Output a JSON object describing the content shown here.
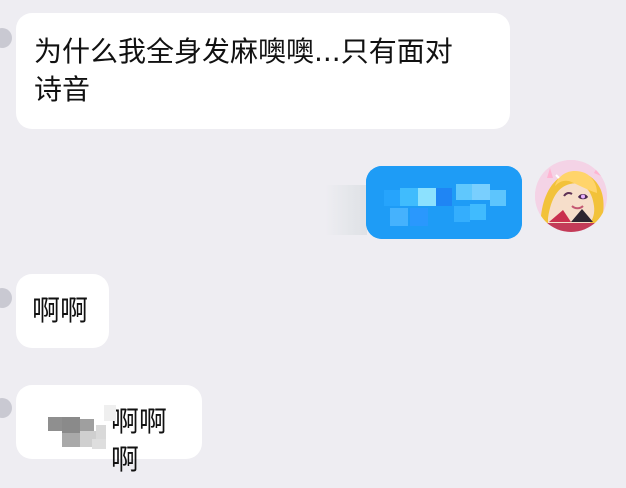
{
  "messages": [
    {
      "side": "left",
      "lines": [
        "为什么我全身发麻噢噢...只有面对",
        "诗音"
      ]
    },
    {
      "side": "right",
      "content": "pixelated image"
    },
    {
      "side": "left",
      "text": "啊啊"
    },
    {
      "side": "left",
      "text": "啊啊啊"
    }
  ],
  "colors": {
    "background": "#eeedf2",
    "bubble_incoming": "#ffffff",
    "bubble_outgoing": "#1e9cf6",
    "text": "#111111"
  },
  "icons": {
    "self_avatar": "anime-girl-avatar"
  }
}
